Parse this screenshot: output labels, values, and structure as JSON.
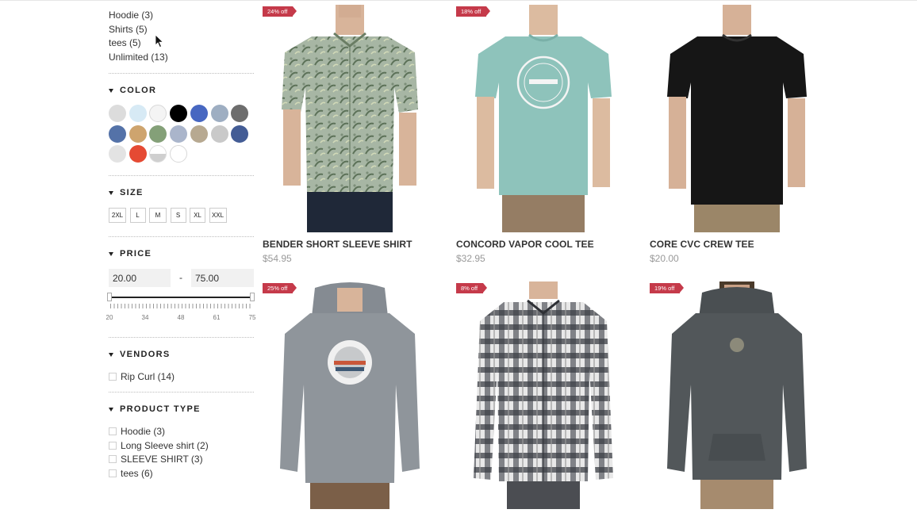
{
  "categories": [
    {
      "label": "Hoodie (3)"
    },
    {
      "label": "Shirts (5)"
    },
    {
      "label": "tees (5)"
    },
    {
      "label": "Unlimited (13)"
    }
  ],
  "sections": {
    "color": "COLOR",
    "size": "SIZE",
    "price": "PRICE",
    "vendors": "VENDORS",
    "product_type": "PRODUCT TYPE"
  },
  "colors": [
    "#dcdcdc",
    "#d7eaf5",
    "#f4f4f4",
    "#000000",
    "#4767c1",
    "#9eaec2",
    "#6d6d6d",
    "#5472a8",
    "#cea46e",
    "#84a078",
    "#aab5cb",
    "#b7a991",
    "#c9c9c9",
    "#435c95",
    "#e3e3e3",
    "#e54a33",
    "split-grey-white",
    "#ffffff"
  ],
  "sizes": [
    "2XL",
    "L",
    "M",
    "S",
    "XL",
    "XXL"
  ],
  "price": {
    "min": "20.00",
    "max": "75.00",
    "dash": "-",
    "tick_labels": [
      "20",
      "34",
      "48",
      "61",
      "75"
    ]
  },
  "vendors": [
    {
      "label": "Rip Curl (14)"
    }
  ],
  "product_types": [
    {
      "label": "Hoodie (3)"
    },
    {
      "label": "Long Sleeve shirt (2)"
    },
    {
      "label": "SLEEVE SHIRT (3)"
    },
    {
      "label": "tees (6)"
    }
  ],
  "products": [
    {
      "title": "BENDER SHORT SLEEVE SHIRT",
      "price": "$54.95",
      "badge": "24% off",
      "image": "floral-short-sleeve-shirt",
      "garment_color": "#9fb0a0"
    },
    {
      "title": "CONCORD VAPOR COOL TEE",
      "price": "$32.95",
      "badge": "18% off",
      "image": "mint-tee-with-logo",
      "garment_color": "#8ec3bb"
    },
    {
      "title": "CORE CVC CREW TEE",
      "price": "$20.00",
      "badge": "",
      "image": "black-crew-tee",
      "garment_color": "#161616"
    },
    {
      "title": "",
      "price": "",
      "badge": "25% off",
      "image": "grey-hoodie-with-circle-logo",
      "garment_color": "#8f959b"
    },
    {
      "title": "",
      "price": "",
      "badge": "8% off",
      "image": "plaid-flannel-shirt",
      "garment_color": "#8a8a8a"
    },
    {
      "title": "",
      "price": "",
      "badge": "19% off",
      "image": "charcoal-hoodie",
      "garment_color": "#52575a"
    }
  ]
}
